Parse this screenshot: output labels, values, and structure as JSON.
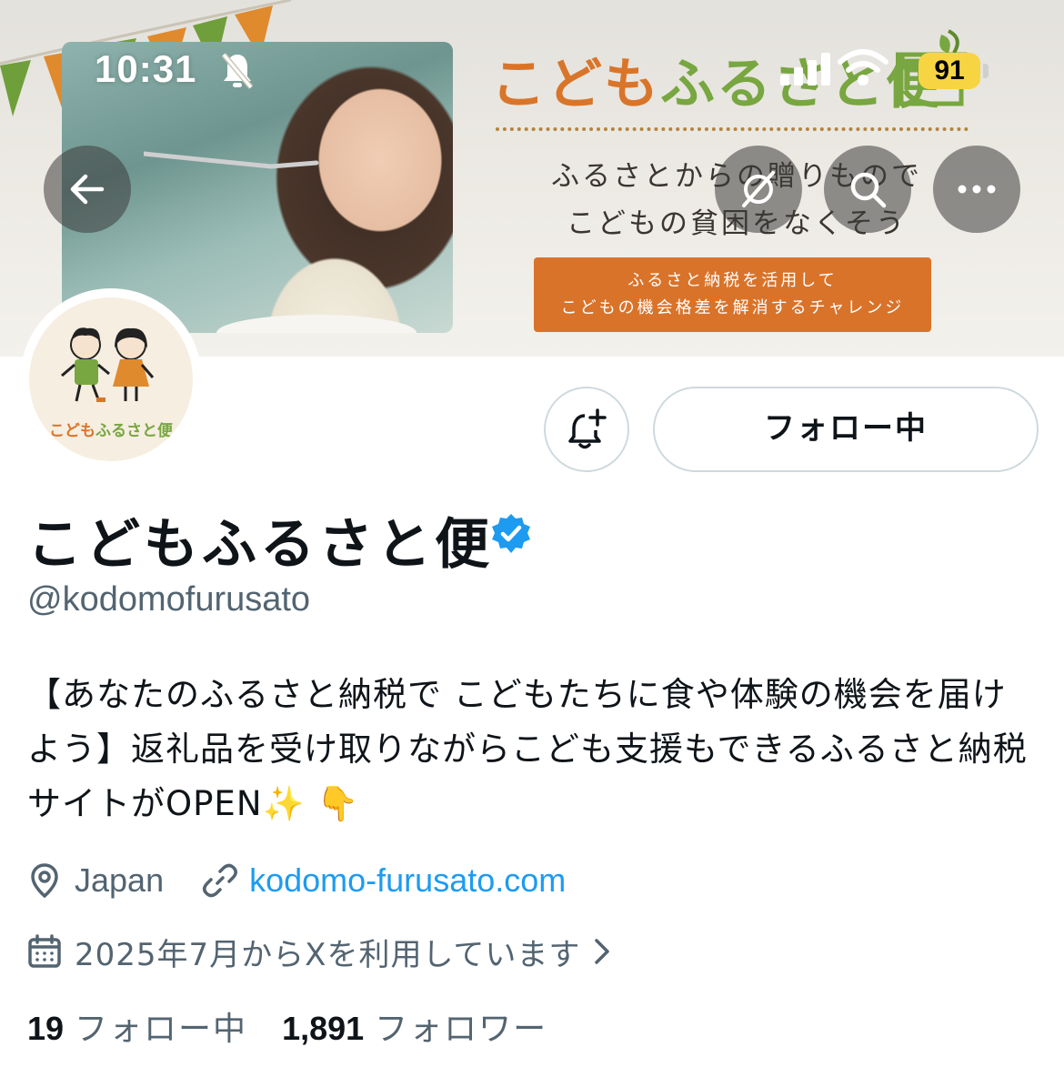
{
  "status_bar": {
    "time": "10:31",
    "battery": "91"
  },
  "banner": {
    "brand_part1": "こども",
    "brand_part2": "ふるさと便",
    "tagline_line1": "ふるさとからの贈りもので",
    "tagline_line2": "こどもの貧困をなくそう",
    "cta_line1": "ふるさと納税を活用して",
    "cta_line2": "こどもの機会格差を解消するチャレンジ"
  },
  "avatar": {
    "logo_part1": "こども",
    "logo_part2": "ふるさと便"
  },
  "actions": {
    "follow_label": "フォロー中"
  },
  "profile": {
    "display_name": "こどもふるさと便",
    "handle": "@kodomofurusato",
    "bio": "【あなたのふるさと納税で こどもたちに食や体験の機会を届けよう】返礼品を受け取りながらこども支援もできるふるさと納税サイトがOPEN✨ 👇",
    "location": "Japan",
    "website": "kodomo-furusato.com",
    "joined": "2025年7月からXを利用しています"
  },
  "stats": {
    "following_count": "19",
    "following_label": "フォロー中",
    "followers_count": "1,891",
    "followers_label": "フォロワー"
  },
  "colors": {
    "brand_orange": "#d9752a",
    "brand_green": "#78a640",
    "link_blue": "#1d9bf0",
    "secondary_text": "#536471",
    "verified_blue": "#1d9bf0"
  }
}
